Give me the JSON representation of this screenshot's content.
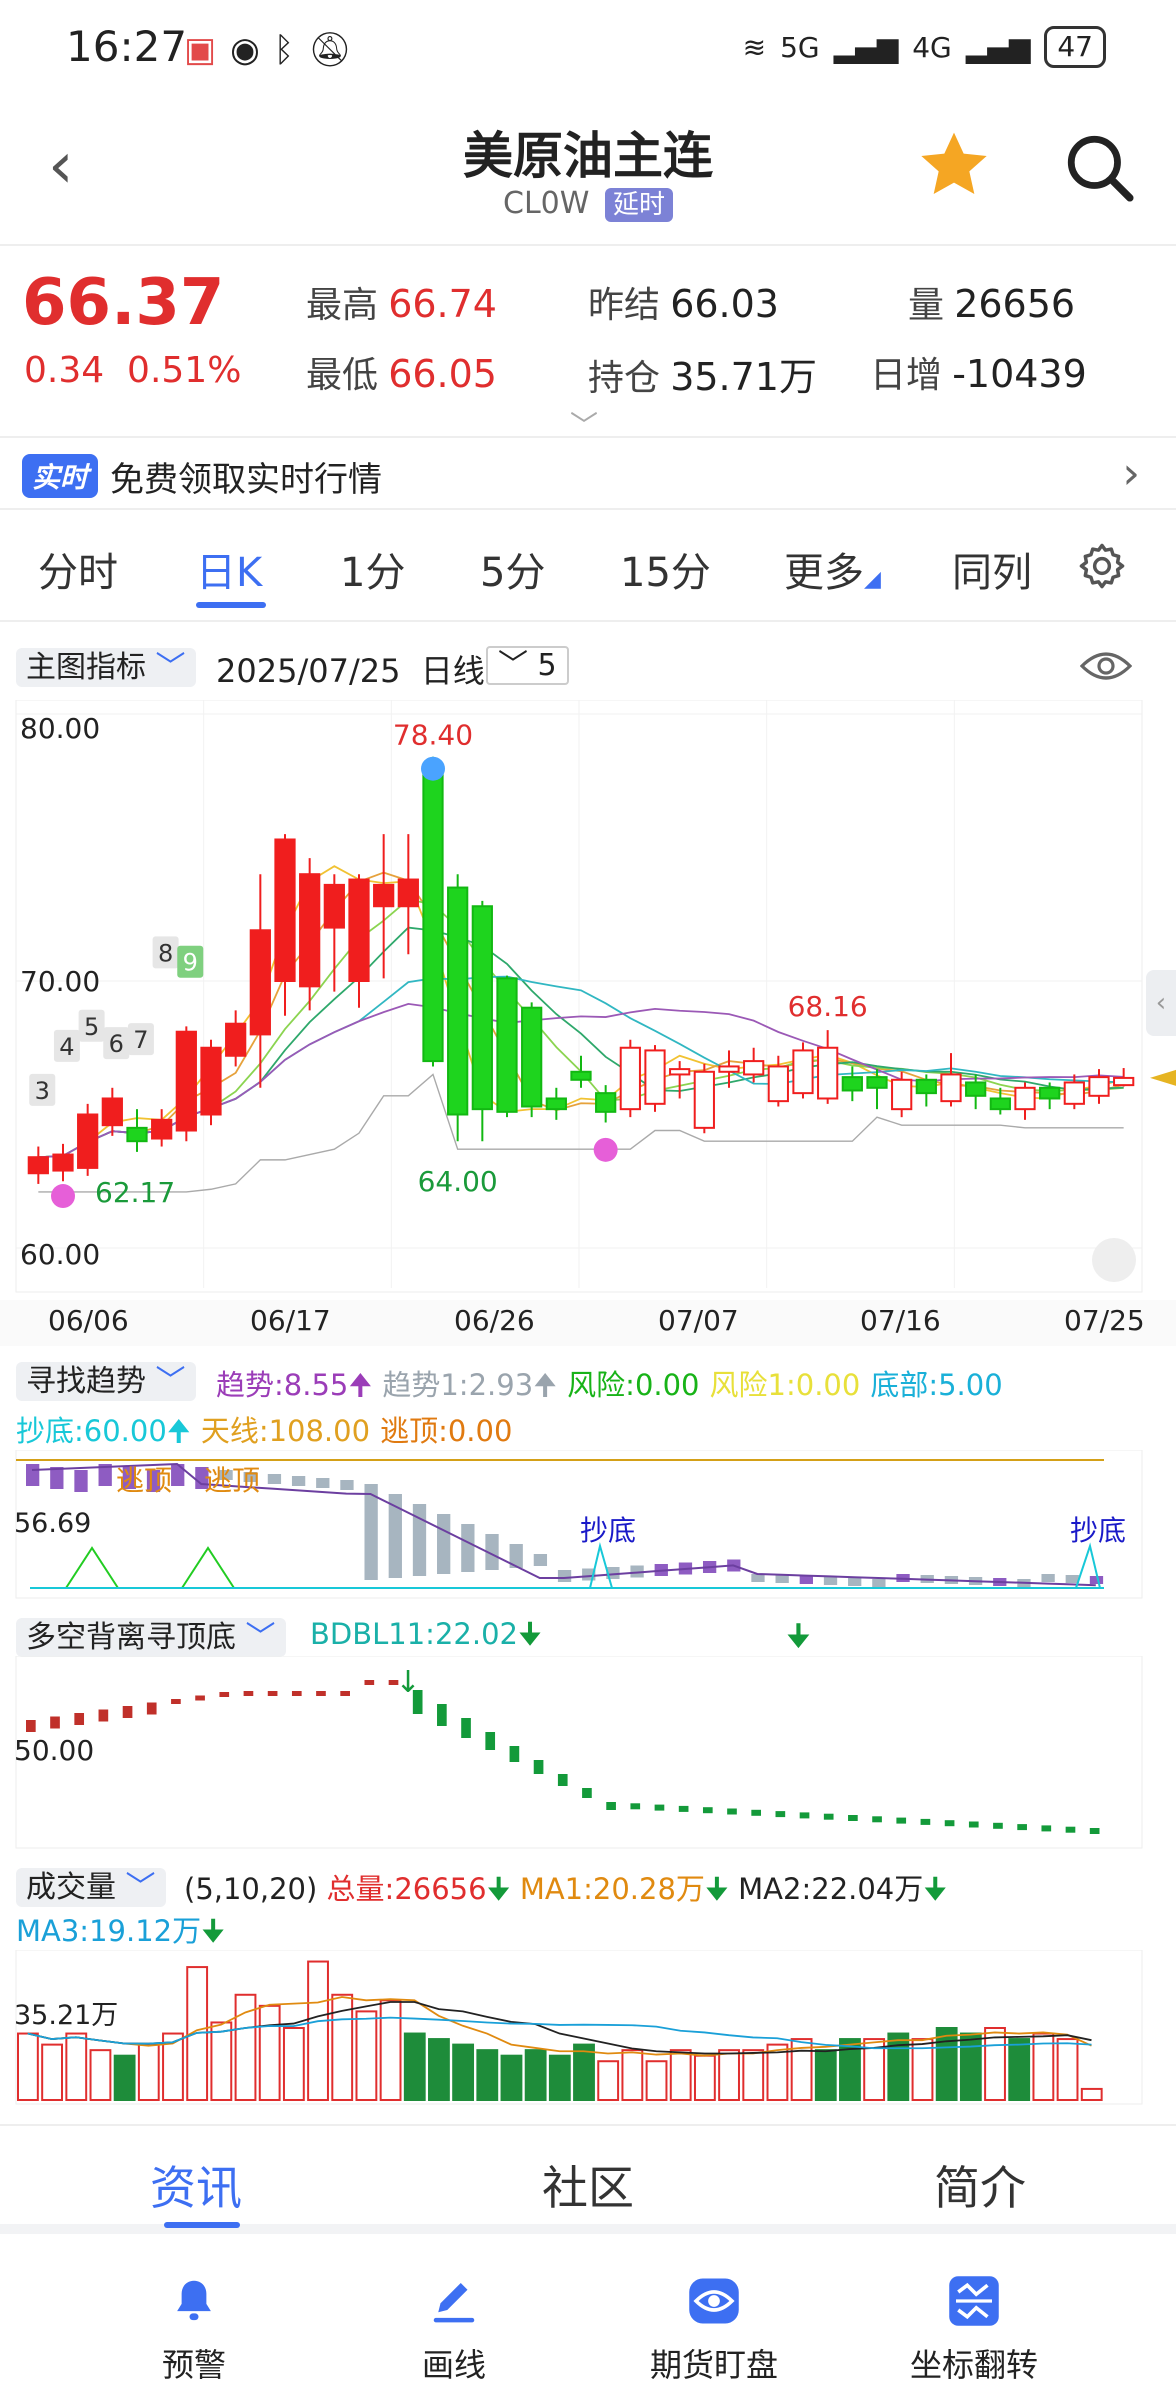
{
  "status_bar": {
    "time": "16:27",
    "network1": "5G",
    "network2": "4G",
    "battery": "47"
  },
  "header": {
    "title": "美原油主连",
    "code": "CL0W",
    "tag": "延时"
  },
  "quote": {
    "price": "66.37",
    "change": "0.34",
    "change_pct": "0.51%",
    "high_label": "最高",
    "high": "66.74",
    "low_label": "最低",
    "low": "66.05",
    "prev_label": "昨结",
    "prev": "66.03",
    "oi_label": "持仓",
    "oi": "35.71万",
    "vol_label": "量",
    "vol": "26656",
    "daily_label": "日增",
    "daily": "-10439"
  },
  "banner": {
    "tag": "实时",
    "text": "免费领取实时行情"
  },
  "tabs": [
    "分时",
    "日K",
    "1分",
    "5分",
    "15分",
    "更多",
    "同列"
  ],
  "toolbar": {
    "indicator": "主图指标",
    "date": "2025/07/25",
    "period": "日线",
    "count": "5"
  },
  "chart_data": [
    {
      "type": "candlestick",
      "ylim": [
        60,
        80
      ],
      "y_ticks": [
        "80.00",
        "70.00",
        "60.00"
      ],
      "x_ticks": [
        "06/06",
        "06/17",
        "06/26",
        "07/07",
        "07/16",
        "07/25"
      ],
      "annotations": {
        "max": "78.40",
        "min_left": "62.17",
        "min_mid": "64.00",
        "peak2": "68.16"
      },
      "count_labels": [
        "3",
        "4",
        "5",
        "6",
        "7",
        "8",
        "9"
      ],
      "candles": [
        {
          "o": 62.8,
          "c": 63.4,
          "h": 63.8,
          "l": 62.4
        },
        {
          "o": 62.9,
          "c": 63.5,
          "h": 63.9,
          "l": 62.5
        },
        {
          "o": 63.0,
          "c": 65.0,
          "h": 65.4,
          "l": 62.7
        },
        {
          "o": 64.6,
          "c": 65.6,
          "h": 66.0,
          "l": 64.2
        },
        {
          "o": 64.5,
          "c": 64.0,
          "h": 65.2,
          "l": 63.6
        },
        {
          "o": 64.1,
          "c": 64.8,
          "h": 65.2,
          "l": 63.8
        },
        {
          "o": 64.4,
          "c": 68.1,
          "h": 68.3,
          "l": 64.0
        },
        {
          "o": 65.0,
          "c": 67.5,
          "h": 67.8,
          "l": 64.6
        },
        {
          "o": 67.2,
          "c": 68.4,
          "h": 68.9,
          "l": 66.8
        },
        {
          "o": 68.0,
          "c": 71.9,
          "h": 74.0,
          "l": 66.0
        },
        {
          "o": 70.0,
          "c": 75.3,
          "h": 75.5,
          "l": 68.7
        },
        {
          "o": 69.8,
          "c": 74.0,
          "h": 74.6,
          "l": 68.9
        },
        {
          "o": 72.0,
          "c": 73.6,
          "h": 74.0,
          "l": 69.6
        },
        {
          "o": 70.0,
          "c": 73.8,
          "h": 74.0,
          "l": 69.0
        },
        {
          "o": 72.8,
          "c": 73.6,
          "h": 75.5,
          "l": 70.1
        },
        {
          "o": 72.8,
          "c": 73.8,
          "h": 75.5,
          "l": 71.0
        },
        {
          "o": 78.0,
          "c": 67.0,
          "h": 78.4,
          "l": 66.8
        },
        {
          "o": 73.5,
          "c": 65.0,
          "h": 74.0,
          "l": 64.0
        },
        {
          "o": 72.8,
          "c": 65.2,
          "h": 73.0,
          "l": 64.0
        },
        {
          "o": 70.1,
          "c": 65.1,
          "h": 70.2,
          "l": 64.9
        },
        {
          "o": 69.0,
          "c": 65.3,
          "h": 69.2,
          "l": 64.9
        },
        {
          "o": 65.6,
          "c": 65.2,
          "h": 66.0,
          "l": 64.8
        },
        {
          "o": 66.6,
          "c": 66.3,
          "h": 67.2,
          "l": 66.0
        },
        {
          "o": 65.8,
          "c": 65.1,
          "h": 66.1,
          "l": 64.7
        },
        {
          "o": 65.2,
          "c": 67.5,
          "h": 67.8,
          "l": 64.9
        },
        {
          "o": 65.4,
          "c": 67.4,
          "h": 67.6,
          "l": 65.1
        },
        {
          "o": 66.5,
          "c": 66.7,
          "h": 67.0,
          "l": 65.6
        },
        {
          "o": 64.5,
          "c": 66.6,
          "h": 66.9,
          "l": 64.3
        },
        {
          "o": 66.6,
          "c": 66.8,
          "h": 67.4,
          "l": 66.0
        },
        {
          "o": 66.5,
          "c": 67.0,
          "h": 67.5,
          "l": 66.2
        },
        {
          "o": 65.5,
          "c": 66.8,
          "h": 67.2,
          "l": 65.3
        },
        {
          "o": 65.8,
          "c": 67.4,
          "h": 67.7,
          "l": 65.6
        },
        {
          "o": 65.6,
          "c": 67.5,
          "h": 68.16,
          "l": 65.4
        },
        {
          "o": 66.4,
          "c": 65.9,
          "h": 66.8,
          "l": 65.5
        },
        {
          "o": 66.4,
          "c": 66.0,
          "h": 66.7,
          "l": 65.2
        },
        {
          "o": 65.2,
          "c": 66.3,
          "h": 66.6,
          "l": 64.9
        },
        {
          "o": 66.3,
          "c": 65.8,
          "h": 66.5,
          "l": 65.3
        },
        {
          "o": 65.5,
          "c": 66.5,
          "h": 67.3,
          "l": 65.3
        },
        {
          "o": 66.2,
          "c": 65.7,
          "h": 66.5,
          "l": 65.2
        },
        {
          "o": 65.6,
          "c": 65.2,
          "h": 66.0,
          "l": 65.0
        },
        {
          "o": 65.2,
          "c": 66.0,
          "h": 66.2,
          "l": 64.8
        },
        {
          "o": 66.0,
          "c": 65.6,
          "h": 66.2,
          "l": 65.2
        },
        {
          "o": 65.4,
          "c": 66.2,
          "h": 66.5,
          "l": 65.2
        },
        {
          "o": 65.7,
          "c": 66.4,
          "h": 66.7,
          "l": 65.4
        },
        {
          "o": 66.1,
          "c": 66.37,
          "h": 66.74,
          "l": 66.05
        }
      ]
    },
    {
      "type": "line",
      "title": "寻找趋势",
      "value_label": "56.69",
      "texts": [
        "逃顶",
        "逃顶",
        "抄底",
        "抄底"
      ]
    },
    {
      "type": "bar",
      "title": "多空背离寻顶底",
      "value_label": "50.00"
    },
    {
      "type": "bar",
      "title": "成交量",
      "value_label": "35.21万",
      "volumes": [
        12,
        10,
        12,
        9,
        8,
        10,
        12,
        24,
        14,
        19,
        17,
        13,
        25,
        19,
        16,
        18,
        12,
        11,
        10,
        9,
        8,
        9,
        8,
        10,
        7,
        9,
        7,
        9,
        8,
        9,
        9,
        10,
        11,
        9,
        11,
        11,
        12,
        11,
        13,
        12,
        13,
        11,
        12,
        11,
        2
      ]
    }
  ],
  "indicators": {
    "trend": {
      "name": "寻找趋势",
      "line1": [
        {
          "text": "趋势:8.55",
          "color": "#9b3db8",
          "arrow": "up"
        },
        {
          "text": "趋势1:2.93",
          "color": "#9aa4ad",
          "arrow": "up"
        },
        {
          "text": "风险:0.00",
          "color": "#18b318"
        },
        {
          "text": "风险1:0.00",
          "color": "#e8e03a"
        },
        {
          "text": "底部:5.00",
          "color": "#1ab0d8"
        }
      ],
      "line2": [
        {
          "text": "抄底:60.00",
          "color": "#18c8d8",
          "arrow": "up"
        },
        {
          "text": "天线:108.00",
          "color": "#e0a020"
        },
        {
          "text": "逃顶:0.00",
          "color": "#e07a10"
        }
      ]
    },
    "bdbl": {
      "name": "多空背离寻顶底",
      "value": "BDBL11:22.02"
    },
    "volume": {
      "name": "成交量",
      "params": "(5,10,20)",
      "total": "总量:26656",
      "ma1": "MA1:20.28万",
      "ma2": "MA2:22.04万",
      "ma3": "MA3:19.12万"
    }
  },
  "bottom_tabs": [
    "资讯",
    "社区",
    "简介"
  ],
  "bottom_nav": [
    "预警",
    "画线",
    "期货盯盘",
    "坐标翻转"
  ]
}
